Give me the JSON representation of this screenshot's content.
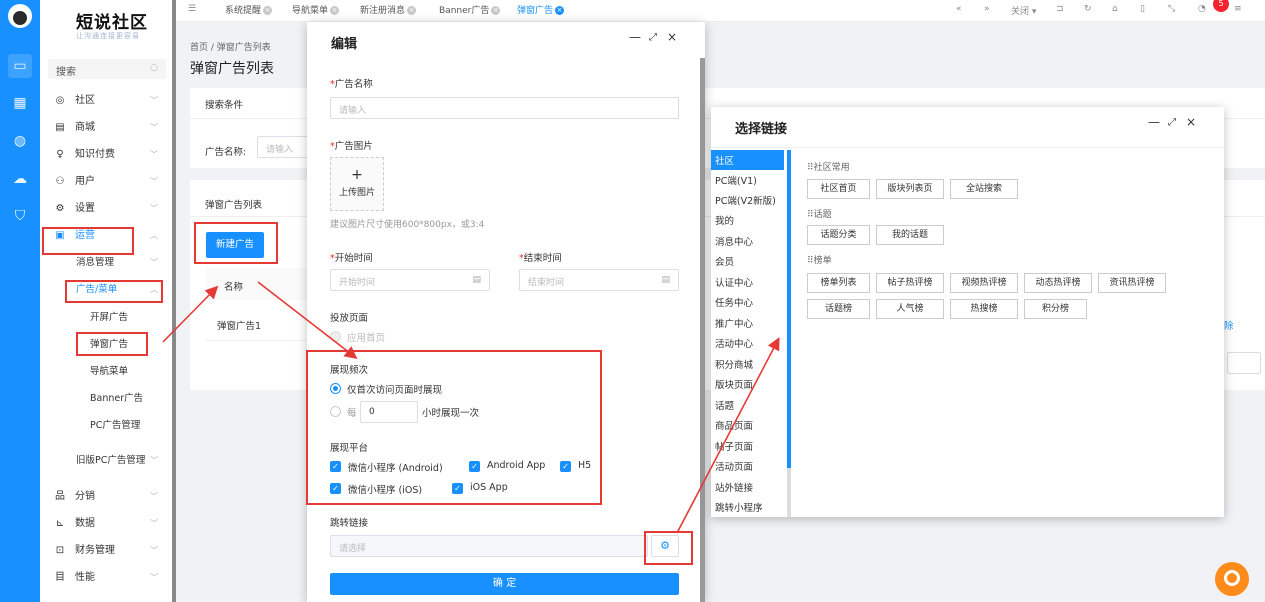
{
  "logo": {
    "title": "短说社区",
    "subtitle": "让沟通连接更容易"
  },
  "menu": {
    "search_placeholder": "搜索",
    "items": [
      {
        "label": "社区"
      },
      {
        "label": "商城"
      },
      {
        "label": "知识付费"
      },
      {
        "label": "用户"
      },
      {
        "label": "设置"
      },
      {
        "label": "运营"
      }
    ],
    "sub_items": [
      {
        "label": "消息管理"
      },
      {
        "label": "广告/菜单"
      },
      {
        "label": "开屏广告"
      },
      {
        "label": "弹窗广告"
      },
      {
        "label": "导航菜单"
      },
      {
        "label": "Banner广告"
      },
      {
        "label": "PC广告管理"
      },
      {
        "label": "旧版PC广告管理"
      }
    ],
    "bottom_items": [
      {
        "label": "分销"
      },
      {
        "label": "数据"
      },
      {
        "label": "财务管理"
      },
      {
        "label": "性能"
      }
    ]
  },
  "tabs": [
    {
      "label": "系统提醒"
    },
    {
      "label": "导航菜单"
    },
    {
      "label": "新注册消息"
    },
    {
      "label": "Banner广告"
    },
    {
      "label": "弹窗广告"
    }
  ],
  "topbar": {
    "close_label": "关闭",
    "badge": "5"
  },
  "page": {
    "breadcrumb": "首页 / 弹窗广告列表",
    "title": "弹窗广告列表",
    "search_header": "搜索条件",
    "name_label": "广告名称:",
    "name_placeholder": "请输入",
    "list_header": "弹窗广告列表",
    "new_button": "新建广告",
    "col_name": "名称",
    "row_name": "弹窗广告1",
    "row_action_partial": "除"
  },
  "edit_modal": {
    "title": "编辑",
    "ad_name_label": "广告名称",
    "ad_name_placeholder": "请输入",
    "ad_image_label": "广告图片",
    "upload_plus": "+",
    "upload_label": "上传图片",
    "image_hint": "建议图片尺寸使用600*800px，或3:4",
    "start_label": "开始时间",
    "start_placeholder": "开始时间",
    "end_label": "结束时间",
    "end_placeholder": "结束时间",
    "page_label": "投放页面",
    "page_option": "应用首页",
    "freq_label": "展现频次",
    "freq_option1": "仅首次访问页面时展现",
    "freq_option2_prefix": "每",
    "freq_value": "0",
    "freq_option2_suffix": "小时展现一次",
    "platform_label": "展现平台",
    "platforms": [
      "微信小程序 (Android)",
      "Android App",
      "H5",
      "微信小程序 (iOS)",
      "iOS App"
    ],
    "jump_label": "跳转链接",
    "jump_placeholder": "请选择",
    "confirm": "确 定"
  },
  "link_modal": {
    "title": "选择链接",
    "categories": [
      "社区",
      "PC端(V1)",
      "PC端(V2新版)",
      "我的",
      "消息中心",
      "会员",
      "认证中心",
      "任务中心",
      "推广中心",
      "活动中心",
      "积分商城",
      "版块页面",
      "话题",
      "商品页面",
      "帖子页面",
      "活动页面",
      "站外链接",
      "跳转小程序"
    ],
    "sections": [
      {
        "title": "社区常用",
        "options": [
          "社区首页",
          "版块列表页",
          "全站搜索"
        ]
      },
      {
        "title": "话题",
        "options": [
          "话题分类",
          "我的话题"
        ]
      },
      {
        "title": "榜单",
        "options": [
          "榜单列表",
          "帖子热评榜",
          "视频热评榜",
          "动态热评榜",
          "资讯热评榜",
          "话题榜",
          "人气榜",
          "热搜榜",
          "积分榜"
        ]
      }
    ]
  },
  "colors": {
    "primary": "#1890ff",
    "annotation": "#e53935",
    "support": "#ff8c1a"
  }
}
